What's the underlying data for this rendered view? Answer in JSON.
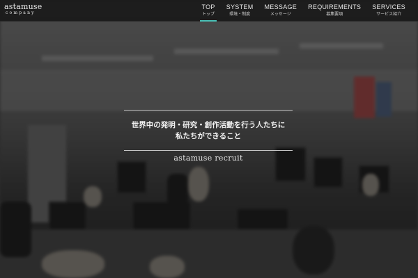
{
  "logo": {
    "main": "astamuse",
    "sub": "company"
  },
  "nav": [
    {
      "en": "TOP",
      "jp": "トップ",
      "active": true
    },
    {
      "en": "SYSTEM",
      "jp": "環境・制度",
      "active": false
    },
    {
      "en": "MESSAGE",
      "jp": "メッセージ",
      "active": false
    },
    {
      "en": "REQUIREMENTS",
      "jp": "募集要項",
      "active": false
    },
    {
      "en": "SERVICES",
      "jp": "サービス紹介",
      "active": false
    }
  ],
  "hero": {
    "tagline_line1": "世界中の発明・研究・創作活動を行う人たちに",
    "tagline_line2": "私たちができること",
    "subtitle": "astamuse recruit"
  },
  "colors": {
    "accent": "#49c0b6",
    "header_bg": "#191919"
  }
}
